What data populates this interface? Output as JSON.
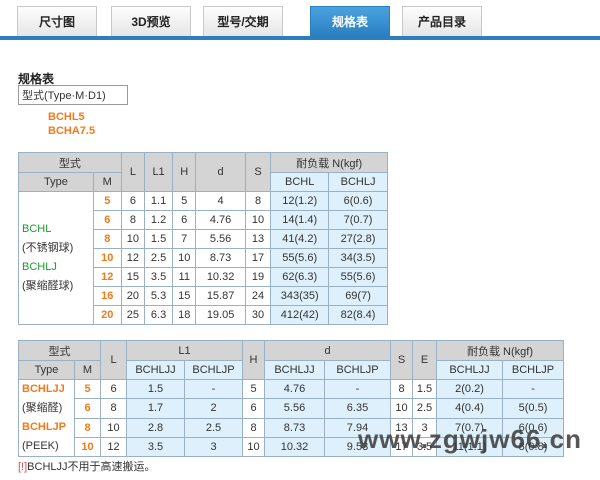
{
  "tabs": [
    {
      "label": "尺寸图",
      "active": false
    },
    {
      "label": "3D预览",
      "active": false
    },
    {
      "label": "型号/交期",
      "active": false
    },
    {
      "label": "规格表",
      "active": true
    },
    {
      "label": "产品目录",
      "active": false
    }
  ],
  "spec": {
    "title": "规格表",
    "code_format": "型式(Type·M·D1)",
    "series": [
      "BCHL5",
      "BCHA7.5"
    ]
  },
  "table1": {
    "h_type": "型式",
    "h_L": "L",
    "h_L1": "L1",
    "h_H": "H",
    "h_d": "d",
    "h_S": "S",
    "h_load": "耐负载 N(kgf)",
    "h_type2": "Type",
    "h_M": "M",
    "h_c1": "BCHL",
    "h_c2": "BCHLJ",
    "type_lines": [
      "BCHL",
      "(不锈钢球)",
      "BCHLJ",
      "(聚缩醛球)"
    ],
    "rows": [
      {
        "m": "5",
        "L": "6",
        "L1": "1.1",
        "H": "5",
        "d": "4",
        "S": "8",
        "a": "12(1.2)",
        "b": "6(0.6)"
      },
      {
        "m": "6",
        "L": "8",
        "L1": "1.2",
        "H": "6",
        "d": "4.76",
        "S": "10",
        "a": "14(1.4)",
        "b": "7(0.7)"
      },
      {
        "m": "8",
        "L": "10",
        "L1": "1.5",
        "H": "7",
        "d": "5.56",
        "S": "13",
        "a": "41(4.2)",
        "b": "27(2.8)"
      },
      {
        "m": "10",
        "L": "12",
        "L1": "2.5",
        "H": "10",
        "d": "8.73",
        "S": "17",
        "a": "55(5.6)",
        "b": "34(3.5)"
      },
      {
        "m": "12",
        "L": "15",
        "L1": "3.5",
        "H": "11",
        "d": "10.32",
        "S": "19",
        "a": "62(6.3)",
        "b": "55(5.6)"
      },
      {
        "m": "16",
        "L": "20",
        "L1": "5.3",
        "H": "15",
        "d": "15.87",
        "S": "24",
        "a": "343(35)",
        "b": "69(7)"
      },
      {
        "m": "20",
        "L": "25",
        "L1": "6.3",
        "H": "18",
        "d": "19.05",
        "S": "30",
        "a": "412(42)",
        "b": "82(8.4)"
      }
    ]
  },
  "table2": {
    "h_type": "型式",
    "h_L": "L",
    "h_L1": "L1",
    "h_H": "H",
    "h_d": "d",
    "h_S": "S",
    "h_E": "E",
    "h_load": "耐负载 N(kgf)",
    "h_type2": "Type",
    "h_M": "M",
    "h_c1": "BCHLJJ",
    "h_c2": "BCHLJP",
    "type_lines": [
      "BCHLJJ",
      "(聚缩醛)",
      "BCHLJP",
      "(PEEK)"
    ],
    "rows": [
      {
        "m": "5",
        "L": "6",
        "l1a": "1.5",
        "l1b": "-",
        "H": "5",
        "da": "4.76",
        "db": "-",
        "S": "8",
        "E": "1.5",
        "na": "2(0.2)",
        "nb": "-"
      },
      {
        "m": "6",
        "L": "8",
        "l1a": "1.7",
        "l1b": "2",
        "H": "6",
        "da": "5.56",
        "db": "6.35",
        "S": "10",
        "E": "2.5",
        "na": "4(0.4)",
        "nb": "5(0.5)"
      },
      {
        "m": "8",
        "L": "10",
        "l1a": "2.8",
        "l1b": "2.5",
        "H": "8",
        "da": "8.73",
        "db": "7.94",
        "S": "13",
        "E": "3",
        "na": "7(0.7)",
        "nb": "6(0.6)"
      },
      {
        "m": "10",
        "L": "12",
        "l1a": "3.5",
        "l1b": "3",
        "H": "10",
        "da": "10.32",
        "db": "9.53",
        "S": "17",
        "E": "3.5",
        "na": "11(1.1)",
        "nb": "8(0.8)"
      }
    ]
  },
  "note": {
    "mark": "[!]",
    "text": "BCHLJJ不用于高速搬运。"
  },
  "watermark": "www.zgwjw66.cn"
}
